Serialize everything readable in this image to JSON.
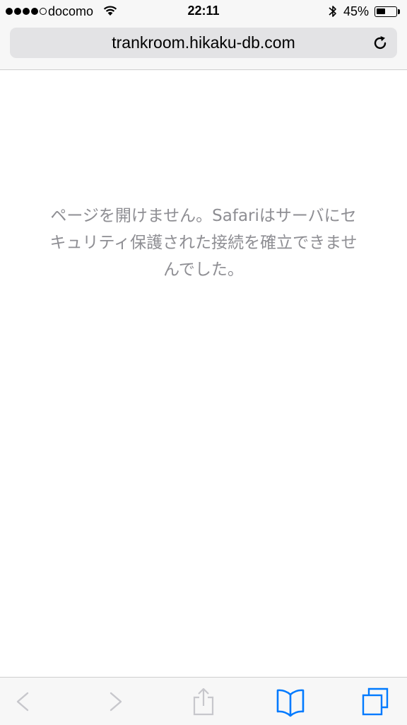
{
  "status_bar": {
    "carrier": "docomo",
    "time": "22:11",
    "battery_percent": "45%",
    "battery_level": 0.45,
    "signal_bars_filled": 4,
    "signal_bars_total": 5
  },
  "address_bar": {
    "url": "trankroom.hikaku-db.com"
  },
  "error": {
    "message": "ページを開けません。Safariはサーバにセキュリティ保護された接続を確立できませんでした。"
  },
  "toolbar": {
    "back_enabled": false,
    "forward_enabled": false,
    "share_enabled": false
  },
  "colors": {
    "accent": "#007aff",
    "disabled": "#c7c7cc",
    "message_text": "#8e8e93"
  },
  "icons": [
    "wifi-icon",
    "bluetooth-icon",
    "battery-icon",
    "reload-icon",
    "back-icon",
    "forward-icon",
    "share-icon",
    "bookmarks-icon",
    "tabs-icon"
  ]
}
